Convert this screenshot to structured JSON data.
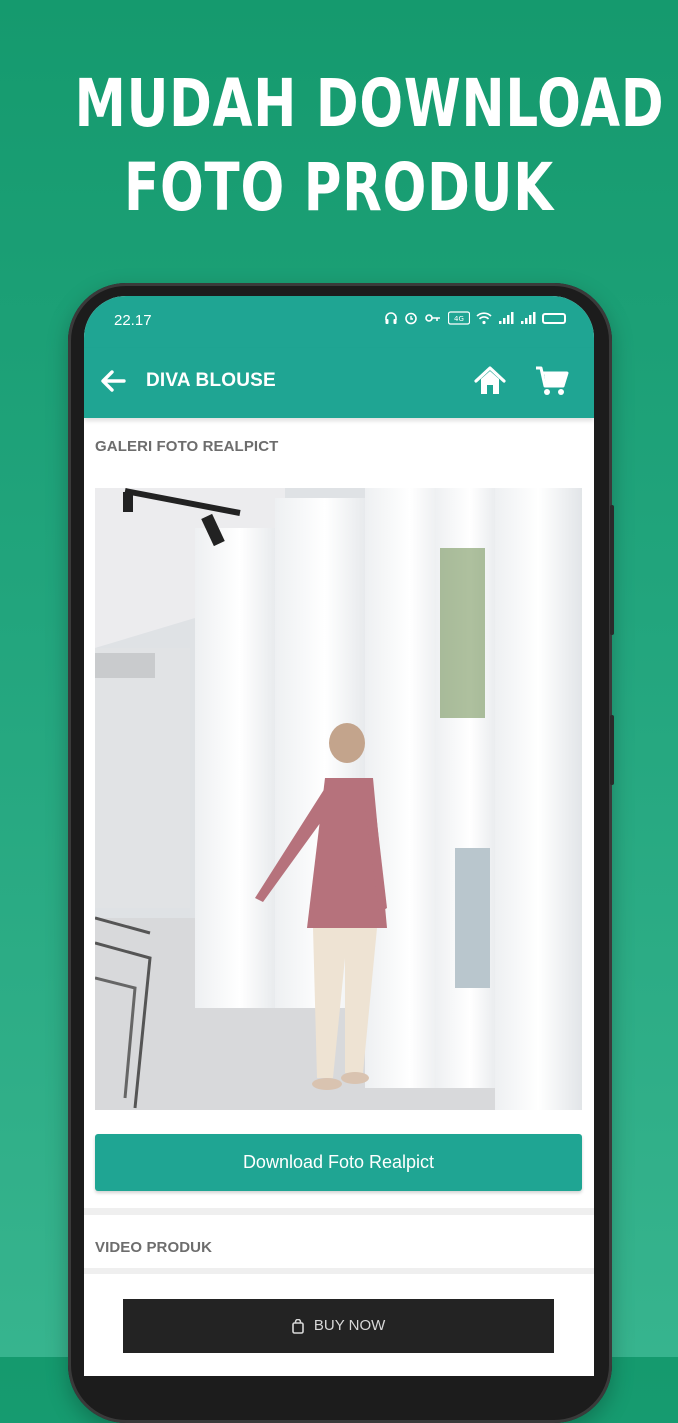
{
  "promo": {
    "headline_line1": "MUDAH DOWNLOAD",
    "headline_line2": "FOTO PRODUK"
  },
  "statusbar": {
    "time": "22.17",
    "icons": [
      "headset-icon",
      "alarm-icon",
      "vpn-key-icon",
      "volte-icon",
      "wifi-icon",
      "signal-icon",
      "signal-icon",
      "battery-icon"
    ]
  },
  "appbar": {
    "title": "DIVA BLOUSE",
    "back_icon": "arrow-left-icon",
    "home_icon": "home-icon",
    "cart_icon": "cart-icon"
  },
  "gallery": {
    "section_title": "GALERI FOTO REALPICT",
    "download_label": "Download Foto Realpict"
  },
  "video": {
    "section_title": "VIDEO PRODUK"
  },
  "buy": {
    "label": "BUY NOW",
    "icon": "shopping-bag-icon"
  },
  "colors": {
    "background_top": "#159a6e",
    "background_bottom": "#37b48e",
    "accent": "#1fa593",
    "buy_button": "#232323"
  }
}
